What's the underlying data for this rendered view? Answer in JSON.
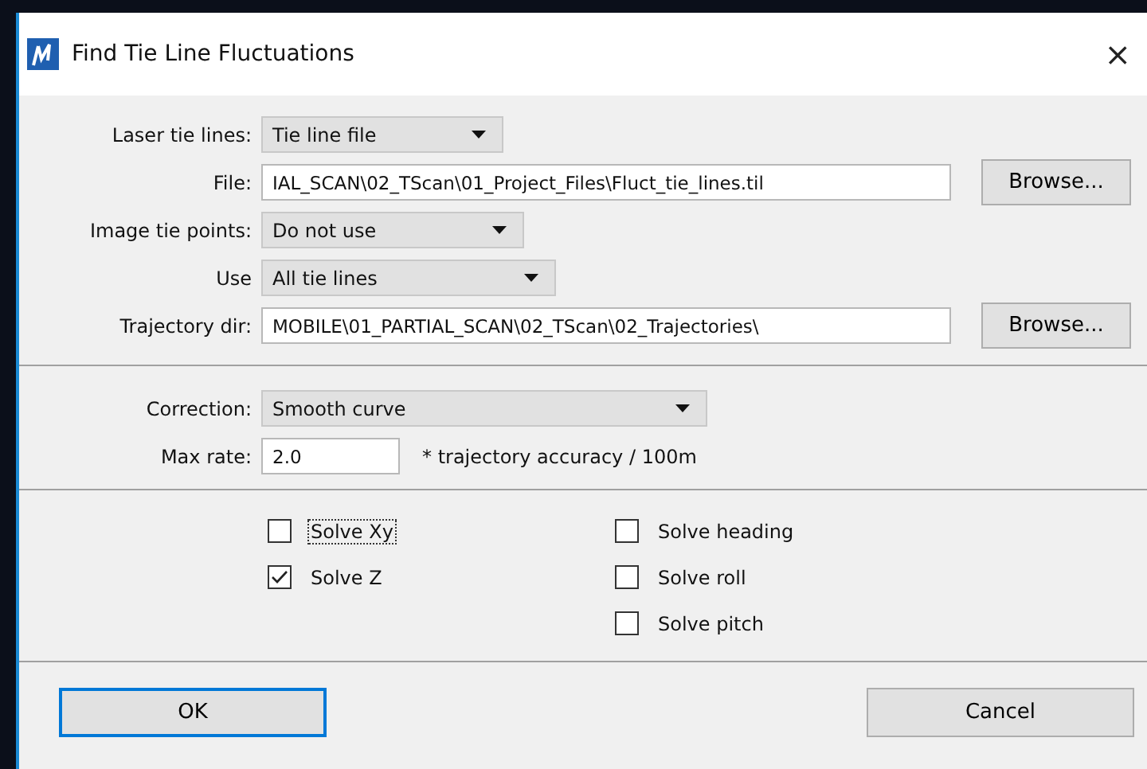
{
  "window": {
    "title": "Find Tie Line Fluctuations",
    "close": "×"
  },
  "source_rows": [
    {
      "kind": "dropdown",
      "label": "Laser tie lines:",
      "value": "Tie line file"
    },
    {
      "kind": "text",
      "label": "File:",
      "value": "IAL_SCAN\\02_TScan\\01_Project_Files\\Fluct_tie_lines.til",
      "button": "Browse..."
    },
    {
      "kind": "dropdown",
      "label": "Image tie points:",
      "value": "Do not use"
    },
    {
      "kind": "dropdown",
      "label": "Use",
      "value": "All tie lines"
    },
    {
      "kind": "text",
      "label": "Trajectory dir:",
      "value": "MOBILE\\01_PARTIAL_SCAN\\02_TScan\\02_Trajectories\\",
      "button": "Browse..."
    }
  ],
  "correction_rows": [
    {
      "kind": "dropdown",
      "label": "Correction:",
      "value": "Smooth curve"
    },
    {
      "kind": "text",
      "label": "Max rate:",
      "value": "2.0",
      "note": "* trajectory accuracy / 100m"
    }
  ],
  "checkbox_columns": [
    [
      {
        "label": "Solve Xy",
        "checked": false,
        "focused": true
      },
      {
        "label": "Solve Z",
        "checked": true,
        "focused": false
      }
    ],
    [
      {
        "label": "Solve heading",
        "checked": false,
        "focused": false
      },
      {
        "label": "Solve roll",
        "checked": false,
        "focused": false
      },
      {
        "label": "Solve pitch",
        "checked": false,
        "focused": false
      }
    ]
  ],
  "buttons": [
    {
      "label": "OK",
      "default": true
    },
    {
      "label": "Cancel",
      "default": false
    }
  ]
}
